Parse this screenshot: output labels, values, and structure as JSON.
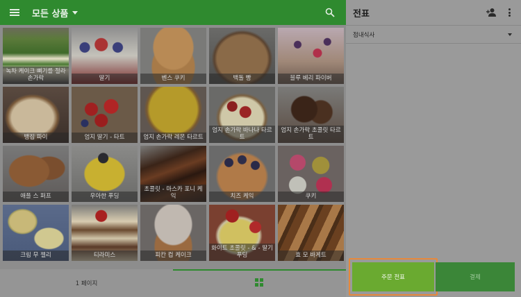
{
  "app": {
    "category_title": "모든 상품",
    "page_label": "1 페이지"
  },
  "products": [
    {
      "name": "녹차 케이크 뼈기를 절라 손가락",
      "art": "greentea"
    },
    {
      "name": "딸기",
      "art": "strawberry"
    },
    {
      "name": "벤스 쿠키",
      "art": "cookie"
    },
    {
      "name": "백돌 빵",
      "art": "bread"
    },
    {
      "name": "블루 베리 파이버",
      "art": "blueberrybar"
    },
    {
      "name": "뱅집 파이",
      "art": "pie"
    },
    {
      "name": "엄지 딸기 - 타트",
      "art": "tart"
    },
    {
      "name": "엄지 손가락 레몬 타르트",
      "art": "lemontart"
    },
    {
      "name": "엄지 손가락 바나나 타르트",
      "art": "bananatart"
    },
    {
      "name": "엄지 손가락 초콜릿 타르트",
      "art": "chocotart"
    },
    {
      "name": "애플 스 퍼프",
      "art": "puff"
    },
    {
      "name": "우아한 푸딩",
      "art": "pudding"
    },
    {
      "name": "초콜릿 - 마스카 포니 케익",
      "art": "chococake"
    },
    {
      "name": "치즈 케익",
      "art": "cheesecake"
    },
    {
      "name": "쿠키",
      "art": "macaron"
    },
    {
      "name": "크림 무 젤리",
      "art": "jelly"
    },
    {
      "name": "티라미스",
      "art": "tiramisu"
    },
    {
      "name": "피칸 컵 케이크",
      "art": "cupcake"
    },
    {
      "name": "화이트 초콜릿 - & - 딸기 푸딩",
      "art": "whitepudding"
    },
    {
      "name": "효 모 바게트",
      "art": "baguette"
    }
  ],
  "ticket": {
    "title": "전표",
    "dining_mode": "점내식사",
    "order_button": "주문 전표",
    "pay_button": "결제"
  },
  "colors": {
    "appbar": "#2f8a2f",
    "order_button": "#6aaa30",
    "pay_button": "#3b8638",
    "highlight": "#e8883a"
  },
  "icons": [
    "menu-icon",
    "chevron-down-icon",
    "search-icon",
    "add-person-icon",
    "more-vert-icon",
    "grid-view-icon"
  ]
}
